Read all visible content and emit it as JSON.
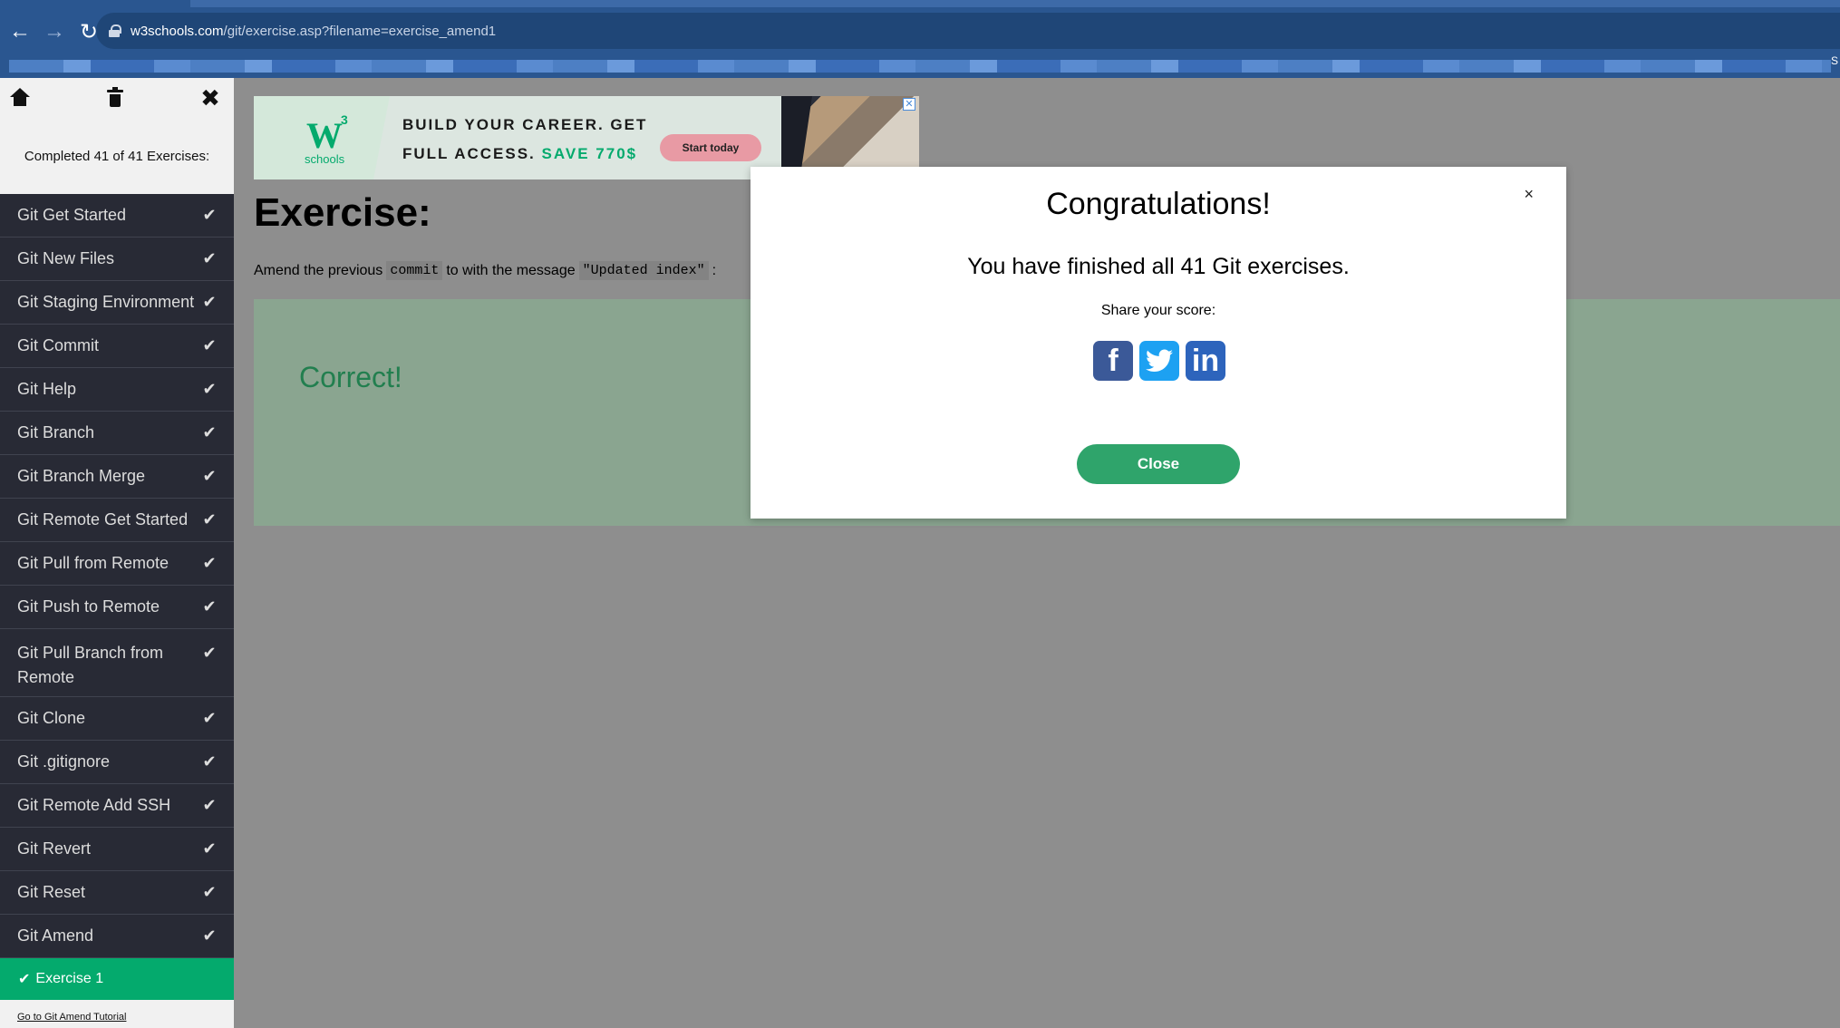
{
  "browser": {
    "url_host": "w3schools.com",
    "url_path": "/git/exercise.asp?filename=exercise_amend1",
    "bookmark_overflow": "S"
  },
  "sidebar": {
    "completed": "Completed 41 of 41 Exercises:",
    "items": [
      {
        "label": "Git Get Started"
      },
      {
        "label": "Git New Files"
      },
      {
        "label": "Git Staging Environment"
      },
      {
        "label": "Git Commit"
      },
      {
        "label": "Git Help"
      },
      {
        "label": "Git Branch"
      },
      {
        "label": "Git Branch Merge"
      },
      {
        "label": "Git Remote Get Started"
      },
      {
        "label": "Git Pull from Remote"
      },
      {
        "label": "Git Push to Remote"
      },
      {
        "label": "Git Pull Branch from Remote"
      },
      {
        "label": "Git Clone"
      },
      {
        "label": "Git .gitignore"
      },
      {
        "label": "Git Remote Add SSH"
      },
      {
        "label": "Git Revert"
      },
      {
        "label": "Git Reset"
      },
      {
        "label": "Git Amend"
      }
    ],
    "current_exercise": "Exercise 1",
    "tutorial_link": "Go to Git Amend Tutorial"
  },
  "ad": {
    "line1": "BUILD YOUR CAREER. GET",
    "line2": "FULL ACCESS.",
    "save": "SAVE 770$",
    "button": "Start today",
    "logo_schools": "schools"
  },
  "exercise": {
    "title": "Exercise:",
    "text_1": "Amend the previous",
    "code_1": "commit",
    "text_2": "to with the message",
    "code_2": "\"Updated index\"",
    "text_3": ":",
    "result": "Correct!"
  },
  "modal": {
    "title": "Congratulations!",
    "message": "You have finished all 41 Git exercises.",
    "share": "Share your score:",
    "close_label": "Close",
    "close_x": "×"
  },
  "colors": {
    "accent": "#04aa6d",
    "sidebar_bg": "#282a35",
    "browser_bar": "#2a5690"
  }
}
